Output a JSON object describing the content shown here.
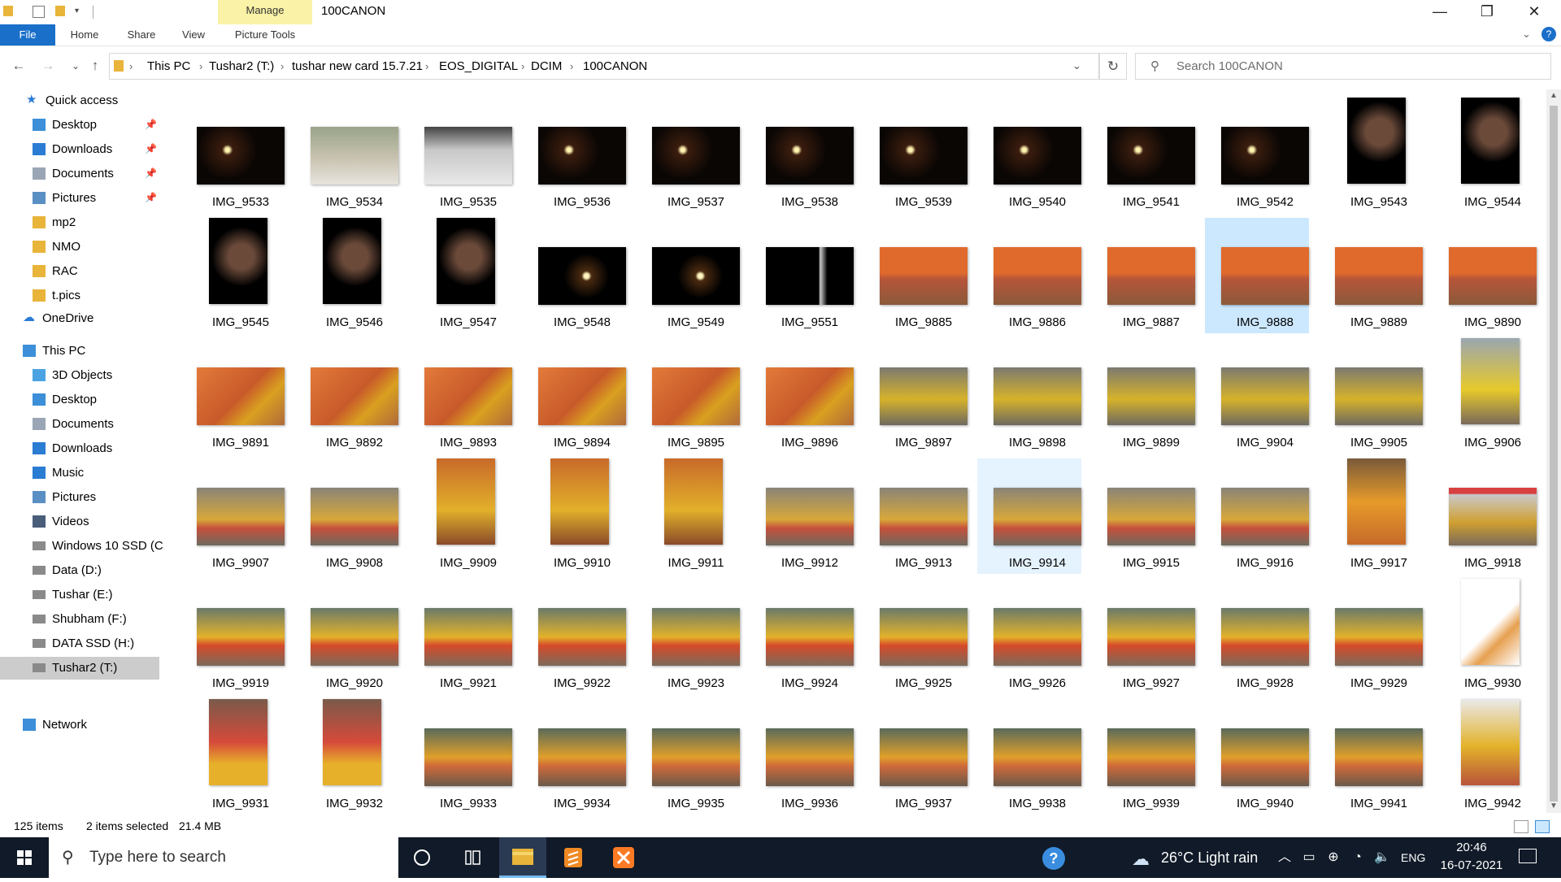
{
  "window": {
    "title": "100CANON",
    "contextual_tab": "Manage",
    "minimize": "—",
    "restore": "❐",
    "close": "✕"
  },
  "ribbon": {
    "tabs": [
      "File",
      "Home",
      "Share",
      "View",
      "Picture Tools"
    ]
  },
  "address": {
    "crumbs": [
      "This PC",
      "Tushar2 (T:)",
      "tushar new card 15.7.21",
      "EOS_DIGITAL",
      "DCIM",
      "100CANON"
    ]
  },
  "search": {
    "placeholder": "Search 100CANON"
  },
  "nav": {
    "quick_access": "Quick access",
    "quick_items": [
      "Desktop",
      "Downloads",
      "Documents",
      "Pictures",
      "mp2",
      "NMO",
      "RAC",
      "t.pics"
    ],
    "onedrive": "OneDrive",
    "this_pc": "This PC",
    "pc_items": [
      "3D Objects",
      "Desktop",
      "Documents",
      "Downloads",
      "Music",
      "Pictures",
      "Videos",
      "Windows 10 SSD (C",
      "Data (D:)",
      "Tushar (E:)",
      "Shubham (F:)",
      "DATA SSD (H:)",
      "Tushar2 (T:)"
    ],
    "network": "Network",
    "selected": "Tushar2 (T:)"
  },
  "files": [
    "IMG_9533",
    "IMG_9534",
    "IMG_9535",
    "IMG_9536",
    "IMG_9537",
    "IMG_9538",
    "IMG_9539",
    "IMG_9540",
    "IMG_9541",
    "IMG_9542",
    "IMG_9543",
    "IMG_9544",
    "IMG_9545",
    "IMG_9546",
    "IMG_9547",
    "IMG_9548",
    "IMG_9549",
    "IMG_9551",
    "IMG_9885",
    "IMG_9886",
    "IMG_9887",
    "IMG_9888",
    "IMG_9889",
    "IMG_9890",
    "IMG_9891",
    "IMG_9892",
    "IMG_9893",
    "IMG_9894",
    "IMG_9895",
    "IMG_9896",
    "IMG_9897",
    "IMG_9898",
    "IMG_9899",
    "IMG_9904",
    "IMG_9905",
    "IMG_9906",
    "IMG_9907",
    "IMG_9908",
    "IMG_9909",
    "IMG_9910",
    "IMG_9911",
    "IMG_9912",
    "IMG_9913",
    "IMG_9914",
    "IMG_9915",
    "IMG_9916",
    "IMG_9917",
    "IMG_9918",
    "IMG_9919",
    "IMG_9920",
    "IMG_9921",
    "IMG_9922",
    "IMG_9923",
    "IMG_9924",
    "IMG_9925",
    "IMG_9926",
    "IMG_9927",
    "IMG_9928",
    "IMG_9929",
    "IMG_9930",
    "IMG_9931",
    "IMG_9932",
    "IMG_9933",
    "IMG_9934",
    "IMG_9935",
    "IMG_9936",
    "IMG_9937",
    "IMG_9938",
    "IMG_9939",
    "IMG_9940",
    "IMG_9941",
    "IMG_9942"
  ],
  "selected_files": [
    "IMG_9888"
  ],
  "hover_file": "IMG_9914",
  "status": {
    "count": "125 items",
    "selected": "2 items selected",
    "size": "21.4 MB"
  },
  "taskbar": {
    "search_placeholder": "Type here to search",
    "weather": "26°C  Light rain",
    "language": "ENG",
    "time": "20:46",
    "date": "16-07-2021"
  },
  "colors": {
    "accent": "#1a6fc9",
    "manage_tab": "#f9f2a7",
    "selection": "#cce8ff",
    "taskbar": "#101a28"
  }
}
